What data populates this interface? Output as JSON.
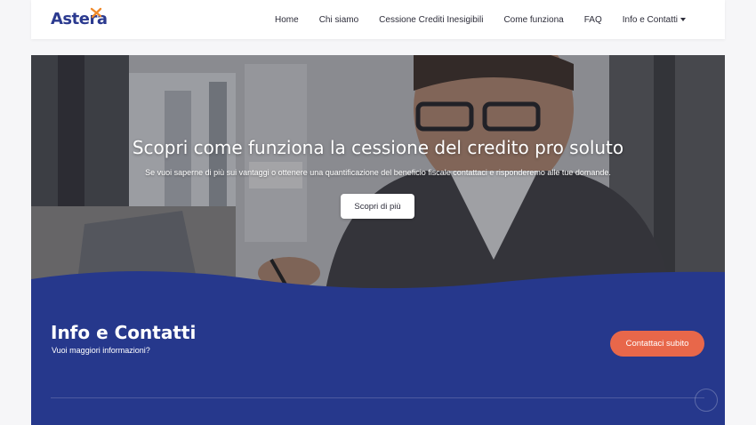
{
  "brand": {
    "name": "Astera",
    "tagline": "",
    "colors": {
      "primary": "#2b3a8f",
      "accent": "#f08a2a",
      "cta": "#e8674a",
      "section_blue": "#26388c"
    }
  },
  "nav": {
    "items": [
      {
        "label": "Home"
      },
      {
        "label": "Chi siamo"
      },
      {
        "label": "Cessione Crediti Inesigibili"
      },
      {
        "label": "Come funziona"
      },
      {
        "label": "FAQ"
      },
      {
        "label": "Info e Contatti",
        "has_dropdown": true,
        "icon": "caret-down-icon"
      }
    ]
  },
  "hero": {
    "title": "Scopri come funziona la cessione del credito pro soluto",
    "subtitle": "Se vuoi saperne di più sui vantaggi o ottenere una quantificazione del beneficio fiscale contattaci e risponderemo alle tue domande.",
    "button_label": "Scopri di più"
  },
  "contact": {
    "title": "Info e Contatti",
    "subtitle": "Vuoi maggiori informazioni?",
    "button_label": "Contattaci subito",
    "scroll_icon": "scroll-top-icon"
  }
}
